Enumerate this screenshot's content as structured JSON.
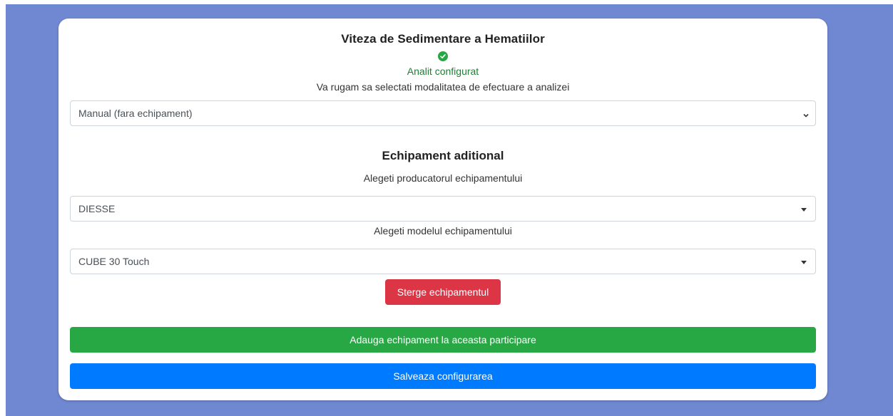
{
  "analysis": {
    "title": "Viteza de Sedimentare a Hematiilor",
    "status": "Analit configurat",
    "status_icon": "check-circle-icon",
    "prompt": "Va rugam sa selectati modalitatea de efectuare a analizei",
    "mode_value": "Manual (fara echipament)"
  },
  "equipment": {
    "title": "Echipament aditional",
    "producer_label": "Alegeti producatorul echipamentului",
    "producer_value": "DIESSE",
    "model_label": "Alegeti modelul echipamentului",
    "model_value": "CUBE 30 Touch",
    "delete_label": "Sterge echipamentul"
  },
  "actions": {
    "add_label": "Adauga echipament la aceasta participare",
    "save_label": "Salveaza configurarea"
  },
  "colors": {
    "backdrop": "#7088d1",
    "success": "#28a745",
    "danger": "#dc3545",
    "primary": "#007bff"
  }
}
